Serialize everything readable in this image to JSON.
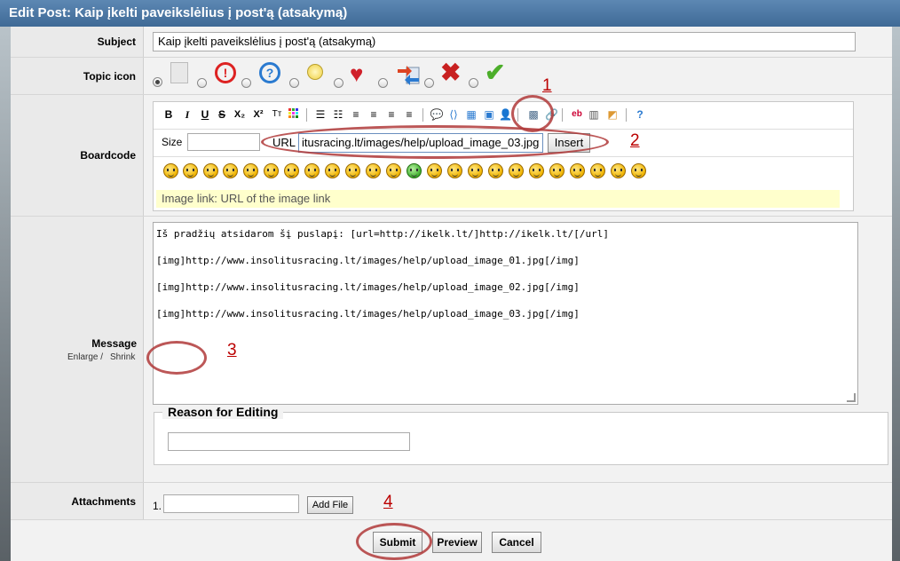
{
  "title": "Edit Post: Kaip įkelti paveikslėlius į post'ą (atsakymą)",
  "subject": {
    "label": "Subject",
    "value": "Kaip įkelti paveikslėlius į post'ą (atsakymą)"
  },
  "topic_icon": {
    "label": "Topic icon",
    "icons": [
      "no-icon",
      "exclamation-icon",
      "question-icon",
      "lightbulb-icon",
      "heart-icon",
      "arrow-icon",
      "x-icon",
      "checkmark-icon"
    ]
  },
  "boardcode": {
    "label": "Boardcode",
    "size_label": "Size",
    "url_label": "URL",
    "url_value": "itusracing.lt/images/help/upload_image_03.jpg",
    "insert_label": "Insert",
    "hint": "Image link: URL of the image link",
    "toolbar": [
      "B",
      "I",
      "U",
      "S",
      "X₂",
      "X²",
      "Tт"
    ]
  },
  "message": {
    "label": "Message",
    "enlarge": "Enlarge /",
    "shrink": "Shrink",
    "lines": [
      "Iš pradžių atsidarom šį puslapį: [url=http://ikelk.lt/]http://ikelk.lt/[/url]",
      "[img]http://www.insolitusracing.lt/images/help/upload_image_01.jpg[/img]",
      "[img]http://www.insolitusracing.lt/images/help/upload_image_02.jpg[/img]",
      "[img]http://www.insolitusracing.lt/images/help/upload_image_03.jpg[/img]"
    ]
  },
  "reason": {
    "legend": "Reason for Editing",
    "value": ""
  },
  "attachments": {
    "label": "Attachments",
    "index": "1.",
    "add_file": "Add File"
  },
  "actions": {
    "submit": "Submit",
    "preview": "Preview",
    "cancel": "Cancel"
  },
  "annotations": [
    "1",
    "2",
    "3",
    "4"
  ],
  "colors": {
    "header": "#4a76a2",
    "annotation": "#b03a3a",
    "hint_bg": "#ffffcc"
  }
}
